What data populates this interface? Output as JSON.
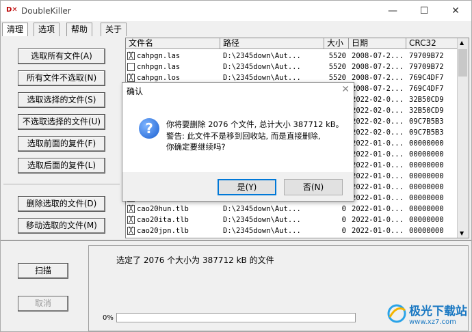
{
  "app": {
    "title": "DoubleKiller",
    "icon_text": "D✕"
  },
  "window_controls": {
    "minimize": "—",
    "maximize": "☐",
    "close": "✕"
  },
  "tabs": [
    "清理",
    "选项",
    "帮助",
    "关于"
  ],
  "left_buttons": {
    "select_all": "选取所有文件(A)",
    "select_none": "所有文件不选取(N)",
    "select_selected": "选取选择的文件(S)",
    "unselect_selected": "不选取选择的文件(U)",
    "select_front": "选取前面的复件(F)",
    "select_back": "选取后面的复件(L)",
    "delete_selected": "删除选取的文件(D)",
    "move_selected": "移动选取的文件(M)"
  },
  "columns": [
    "文件名",
    "路径",
    "大小",
    "日期",
    "CRC32"
  ],
  "rows": [
    {
      "checked": true,
      "name": "cahpgn.las",
      "path": "D:\\2345down\\Aut...",
      "size": "5520",
      "date": "2008-07-2...",
      "crc": "79709B72"
    },
    {
      "checked": false,
      "name": "cnhpgn.las",
      "path": "D:\\2345down\\Aut...",
      "size": "5520",
      "date": "2008-07-2...",
      "crc": "79709B72"
    },
    {
      "checked": true,
      "name": "cahpgn.los",
      "path": "D:\\2345down\\Aut...",
      "size": "5520",
      "date": "2008-07-2...",
      "crc": "769C4DF7"
    },
    {
      "checked": false,
      "name": "",
      "path": "",
      "size": "",
      "date": "2008-07-2...",
      "crc": "769C4DF7"
    },
    {
      "checked": false,
      "name": "",
      "path": "",
      "size": "",
      "date": "2022-02-0...",
      "crc": "32B50CD9"
    },
    {
      "checked": false,
      "name": "",
      "path": "",
      "size": "",
      "date": "2022-02-0...",
      "crc": "32B50CD9"
    },
    {
      "checked": false,
      "name": "",
      "path": "",
      "size": "",
      "date": "2022-02-0...",
      "crc": "09C7B5B3"
    },
    {
      "checked": false,
      "name": "",
      "path": "",
      "size": "",
      "date": "2022-02-0...",
      "crc": "09C7B5B3"
    },
    {
      "checked": false,
      "name": "",
      "path": "",
      "size": "",
      "date": "2022-01-0...",
      "crc": "00000000"
    },
    {
      "checked": false,
      "name": "",
      "path": "",
      "size": "",
      "date": "2022-01-0...",
      "crc": "00000000"
    },
    {
      "checked": false,
      "name": "",
      "path": "",
      "size": "",
      "date": "2022-01-0...",
      "crc": "00000000"
    },
    {
      "checked": false,
      "name": "",
      "path": "",
      "size": "",
      "date": "2022-01-0...",
      "crc": "00000000"
    },
    {
      "checked": false,
      "name": "",
      "path": "",
      "size": "",
      "date": "2022-01-0...",
      "crc": "00000000"
    },
    {
      "checked": false,
      "name": "",
      "path": "",
      "size": "",
      "date": "2022-01-0...",
      "crc": "00000000"
    },
    {
      "checked": true,
      "name": "cao20hun.tlb",
      "path": "D:\\2345down\\Aut...",
      "size": "0",
      "date": "2022-01-0...",
      "crc": "00000000"
    },
    {
      "checked": true,
      "name": "cao20ita.tlb",
      "path": "D:\\2345down\\Aut...",
      "size": "0",
      "date": "2022-01-0...",
      "crc": "00000000"
    },
    {
      "checked": true,
      "name": "cao20jpn.tlb",
      "path": "D:\\2345down\\Aut...",
      "size": "0",
      "date": "2022-01-0...",
      "crc": "00000000"
    }
  ],
  "bottom": {
    "scan": "扫描",
    "cancel": "取消",
    "status": "选定了 2076 个大小为 387712 kB 的文件",
    "progress_percent": "0%",
    "progress": 0
  },
  "dialog": {
    "title": "确认",
    "close": "✕",
    "icon": "?",
    "line1": "你将要删除 2076 个文件, 总计大小 387712 kB。",
    "line2": "警告: 此文件不是移到回收站, 而是直接删除,",
    "line3": "你确定要继续吗?",
    "yes": "是(Y)",
    "no": "否(N)"
  },
  "watermark": {
    "name": "极光下载站",
    "url": "www.xz7.com"
  }
}
